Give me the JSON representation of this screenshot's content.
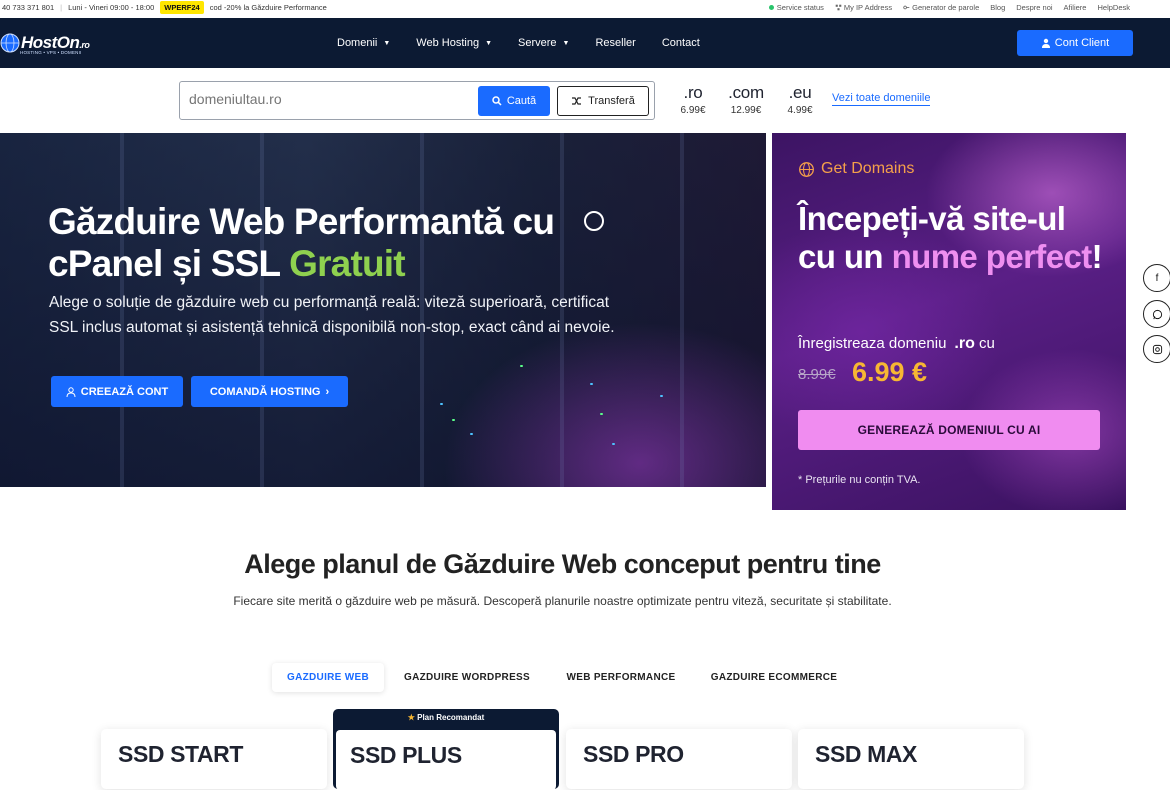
{
  "topbar": {
    "phone": "40 733 371 801",
    "hours": "Luni - Vineri 09:00 - 18:00",
    "promo_code": "WPERF24",
    "promo_text": "cod -20% la Găzduire Performance",
    "links": [
      "Service status",
      "My IP Address",
      "Generator de parole",
      "Blog",
      "Despre noi",
      "Afiliere",
      "HelpDesk"
    ]
  },
  "brand": {
    "name": "HostOn",
    "tld": ".ro",
    "tagline": "HOSTING • VPS • DOMENII"
  },
  "nav": {
    "items": [
      "Domenii",
      "Web Hosting",
      "Servere",
      "Reseller",
      "Contact"
    ],
    "client_button": "Cont Client"
  },
  "domain_search": {
    "placeholder": "domeniultau.ro",
    "search_label": "Caută",
    "transfer_label": "Transferă",
    "tlds": [
      {
        "name": ".ro",
        "price": "6.99€"
      },
      {
        "name": ".com",
        "price": "12.99€"
      },
      {
        "name": ".eu",
        "price": "4.99€"
      }
    ],
    "all_domains_link": "Vezi toate domeniile"
  },
  "hero": {
    "title_main": "Găzduire Web Performantă cu cPanel și SSL ",
    "title_accent": "Gratuit",
    "description": "Alege o soluție de găzduire web cu performanță reală: viteză superioară, certificat SSL inclus automat și asistență tehnică disponibilă non-stop, exact când ai nevoie.",
    "btn_create": "CREEAZĂ CONT",
    "btn_order": "COMANDĂ HOSTING"
  },
  "promo": {
    "brand": "Get Domains",
    "title_line": "Începeți-vă site-ul cu un ",
    "title_accent": "nume perfect",
    "title_end": "!",
    "subtitle": "Înregistreaza domeniu",
    "subtitle_tld": ".ro",
    "subtitle_end": "cu",
    "old_price": "8.99€",
    "new_price": "6.99 €",
    "button": "GENEREAZĂ DOMENIUL CU AI",
    "note": "* Prețurile nu conțin TVA."
  },
  "plans": {
    "title": "Alege planul de Găzduire Web conceput pentru tine",
    "subtitle": "Fiecare site merită o găzduire web pe măsură. Descoperă planurile noastre optimizate pentru viteză, securitate și stabilitate.",
    "tabs": [
      "GAZDUIRE WEB",
      "GAZDUIRE WORDPRESS",
      "WEB PERFORMANCE",
      "GAZDUIRE ECOMMERCE"
    ],
    "active_tab": "GAZDUIRE WEB",
    "recommended_label": "Plan Recomandat",
    "cards": [
      "SSD START",
      "SSD PLUS",
      "SSD PRO",
      "SSD MAX"
    ]
  },
  "colors": {
    "navy": "#0c1a33",
    "primary": "#1a6bff",
    "accent_green": "#8fd14f",
    "promo_pink": "#f08cf0",
    "price_gold": "#f7b733"
  },
  "icons": [
    "user-icon",
    "search-icon",
    "shuffle-icon",
    "globe-icon",
    "chat-icon",
    "facebook-icon",
    "whatsapp-icon",
    "instagram-icon",
    "star-icon"
  ]
}
